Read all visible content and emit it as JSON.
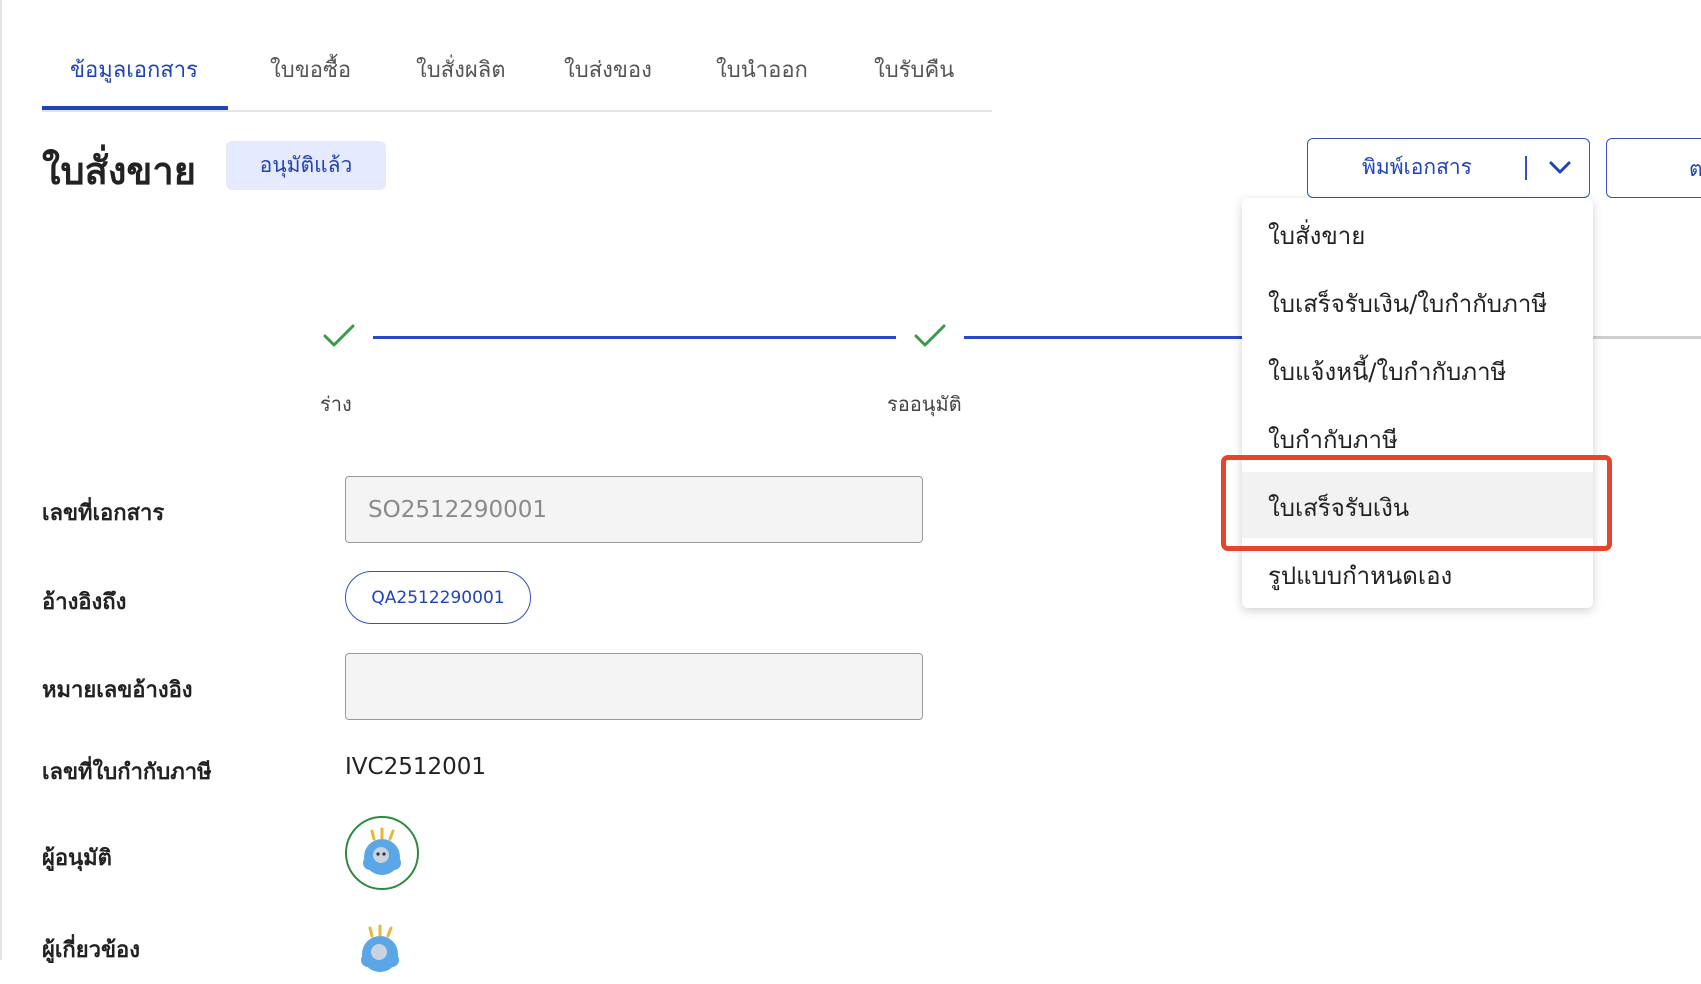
{
  "tabs": [
    {
      "label": "ข้อมูลเอกสาร",
      "active": true
    },
    {
      "label": "ใบขอซื้อ"
    },
    {
      "label": "ใบสั่งผลิต"
    },
    {
      "label": "ใบส่งของ"
    },
    {
      "label": "ใบนำออก"
    },
    {
      "label": "ใบรับคืน"
    }
  ],
  "header": {
    "title": "ใบสั่งขาย",
    "status_badge": "อนุมัติแล้ว",
    "print_button": "พิมพ์เอกสาร",
    "next_button_partial": "ต"
  },
  "stepper": {
    "steps": [
      "ร่าง",
      "รออนุมัติ"
    ]
  },
  "print_menu": {
    "items": [
      "ใบสั่งขาย",
      "ใบเสร็จรับเงิน/ใบกำกับภาษี",
      "ใบแจ้งหนี้/ใบกำกับภาษี",
      "ใบกำกับภาษี",
      "ใบเสร็จรับเงิน",
      "รูปแบบกำหนดเอง"
    ],
    "highlighted": "ใบเสร็จรับเงิน"
  },
  "form": {
    "doc_no_label": "เลขที่เอกสาร",
    "doc_no_value": "SO2512290001",
    "reference_label": "อ้างอิงถึง",
    "reference_chip": "QA2512290001",
    "ref_number_label": "หมายเลขอ้างอิง",
    "ref_number_value": "",
    "tax_invoice_label": "เลขที่ใบกำกับภาษี",
    "tax_invoice_value": "IVC2512001",
    "approver_label": "ผู้อนุมัติ",
    "related_label": "ผู้เกี่ยวข้อง"
  },
  "colors": {
    "primary": "#1f43b8",
    "badge_bg": "#e5eaff",
    "check": "#3a9a4a",
    "highlight": "#e5462b"
  }
}
